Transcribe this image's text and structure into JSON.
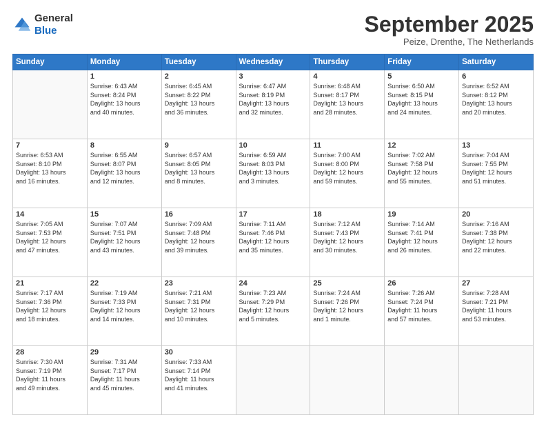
{
  "logo": {
    "line1": "General",
    "line2": "Blue"
  },
  "header": {
    "month": "September 2025",
    "location": "Peize, Drenthe, The Netherlands"
  },
  "weekdays": [
    "Sunday",
    "Monday",
    "Tuesday",
    "Wednesday",
    "Thursday",
    "Friday",
    "Saturday"
  ],
  "weeks": [
    [
      {
        "day": "",
        "info": ""
      },
      {
        "day": "1",
        "info": "Sunrise: 6:43 AM\nSunset: 8:24 PM\nDaylight: 13 hours\nand 40 minutes."
      },
      {
        "day": "2",
        "info": "Sunrise: 6:45 AM\nSunset: 8:22 PM\nDaylight: 13 hours\nand 36 minutes."
      },
      {
        "day": "3",
        "info": "Sunrise: 6:47 AM\nSunset: 8:19 PM\nDaylight: 13 hours\nand 32 minutes."
      },
      {
        "day": "4",
        "info": "Sunrise: 6:48 AM\nSunset: 8:17 PM\nDaylight: 13 hours\nand 28 minutes."
      },
      {
        "day": "5",
        "info": "Sunrise: 6:50 AM\nSunset: 8:15 PM\nDaylight: 13 hours\nand 24 minutes."
      },
      {
        "day": "6",
        "info": "Sunrise: 6:52 AM\nSunset: 8:12 PM\nDaylight: 13 hours\nand 20 minutes."
      }
    ],
    [
      {
        "day": "7",
        "info": "Sunrise: 6:53 AM\nSunset: 8:10 PM\nDaylight: 13 hours\nand 16 minutes."
      },
      {
        "day": "8",
        "info": "Sunrise: 6:55 AM\nSunset: 8:07 PM\nDaylight: 13 hours\nand 12 minutes."
      },
      {
        "day": "9",
        "info": "Sunrise: 6:57 AM\nSunset: 8:05 PM\nDaylight: 13 hours\nand 8 minutes."
      },
      {
        "day": "10",
        "info": "Sunrise: 6:59 AM\nSunset: 8:03 PM\nDaylight: 13 hours\nand 3 minutes."
      },
      {
        "day": "11",
        "info": "Sunrise: 7:00 AM\nSunset: 8:00 PM\nDaylight: 12 hours\nand 59 minutes."
      },
      {
        "day": "12",
        "info": "Sunrise: 7:02 AM\nSunset: 7:58 PM\nDaylight: 12 hours\nand 55 minutes."
      },
      {
        "day": "13",
        "info": "Sunrise: 7:04 AM\nSunset: 7:55 PM\nDaylight: 12 hours\nand 51 minutes."
      }
    ],
    [
      {
        "day": "14",
        "info": "Sunrise: 7:05 AM\nSunset: 7:53 PM\nDaylight: 12 hours\nand 47 minutes."
      },
      {
        "day": "15",
        "info": "Sunrise: 7:07 AM\nSunset: 7:51 PM\nDaylight: 12 hours\nand 43 minutes."
      },
      {
        "day": "16",
        "info": "Sunrise: 7:09 AM\nSunset: 7:48 PM\nDaylight: 12 hours\nand 39 minutes."
      },
      {
        "day": "17",
        "info": "Sunrise: 7:11 AM\nSunset: 7:46 PM\nDaylight: 12 hours\nand 35 minutes."
      },
      {
        "day": "18",
        "info": "Sunrise: 7:12 AM\nSunset: 7:43 PM\nDaylight: 12 hours\nand 30 minutes."
      },
      {
        "day": "19",
        "info": "Sunrise: 7:14 AM\nSunset: 7:41 PM\nDaylight: 12 hours\nand 26 minutes."
      },
      {
        "day": "20",
        "info": "Sunrise: 7:16 AM\nSunset: 7:38 PM\nDaylight: 12 hours\nand 22 minutes."
      }
    ],
    [
      {
        "day": "21",
        "info": "Sunrise: 7:17 AM\nSunset: 7:36 PM\nDaylight: 12 hours\nand 18 minutes."
      },
      {
        "day": "22",
        "info": "Sunrise: 7:19 AM\nSunset: 7:33 PM\nDaylight: 12 hours\nand 14 minutes."
      },
      {
        "day": "23",
        "info": "Sunrise: 7:21 AM\nSunset: 7:31 PM\nDaylight: 12 hours\nand 10 minutes."
      },
      {
        "day": "24",
        "info": "Sunrise: 7:23 AM\nSunset: 7:29 PM\nDaylight: 12 hours\nand 5 minutes."
      },
      {
        "day": "25",
        "info": "Sunrise: 7:24 AM\nSunset: 7:26 PM\nDaylight: 12 hours\nand 1 minute."
      },
      {
        "day": "26",
        "info": "Sunrise: 7:26 AM\nSunset: 7:24 PM\nDaylight: 11 hours\nand 57 minutes."
      },
      {
        "day": "27",
        "info": "Sunrise: 7:28 AM\nSunset: 7:21 PM\nDaylight: 11 hours\nand 53 minutes."
      }
    ],
    [
      {
        "day": "28",
        "info": "Sunrise: 7:30 AM\nSunset: 7:19 PM\nDaylight: 11 hours\nand 49 minutes."
      },
      {
        "day": "29",
        "info": "Sunrise: 7:31 AM\nSunset: 7:17 PM\nDaylight: 11 hours\nand 45 minutes."
      },
      {
        "day": "30",
        "info": "Sunrise: 7:33 AM\nSunset: 7:14 PM\nDaylight: 11 hours\nand 41 minutes."
      },
      {
        "day": "",
        "info": ""
      },
      {
        "day": "",
        "info": ""
      },
      {
        "day": "",
        "info": ""
      },
      {
        "day": "",
        "info": ""
      }
    ]
  ]
}
